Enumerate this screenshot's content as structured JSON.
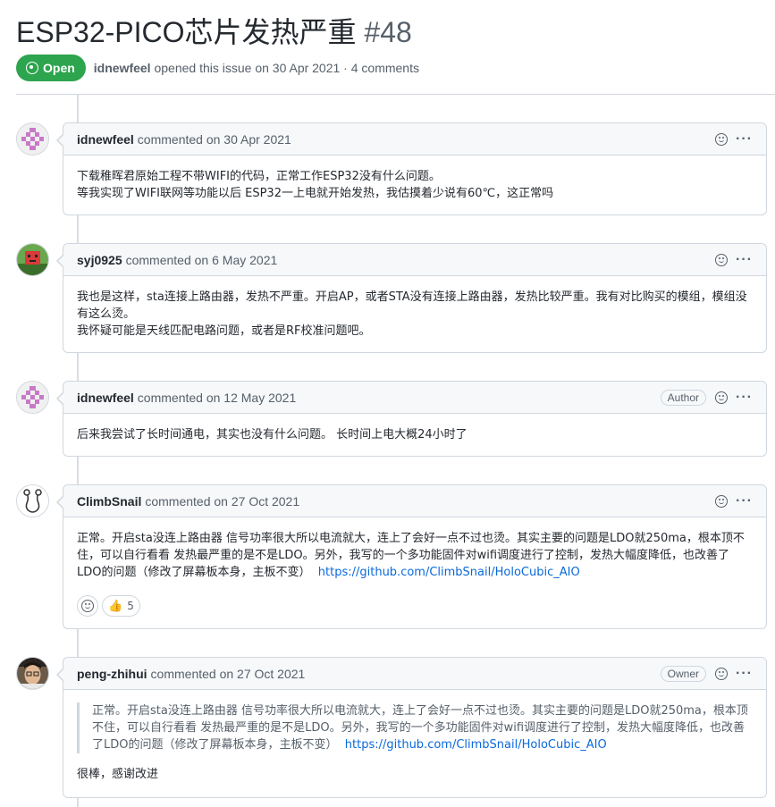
{
  "issue": {
    "title": "ESP32-PICO芯片发热严重",
    "number": "#48",
    "state": "Open",
    "opened_by": "idnewfeel",
    "opened_text": "opened this issue on 30 Apr 2021 · 4 comments"
  },
  "comments": [
    {
      "author": "idnewfeel",
      "meta": "commented on 30 Apr 2021",
      "badge": "",
      "lines": [
        "下载稚晖君原始工程不带WIFI的代码，正常工作ESP32没有什么问题。",
        "等我实现了WIFI联网等功能以后 ESP32一上电就开始发热，我估摸着少说有60℃，这正常吗"
      ]
    },
    {
      "author": "syj0925",
      "meta": "commented on 6 May 2021",
      "badge": "",
      "lines": [
        "我也是这样，sta连接上路由器，发热不严重。开启AP，或者STA没有连接上路由器，发热比较严重。我有对比购买的模组，模组没有这么烫。",
        "我怀疑可能是天线匹配电路问题，或者是RF校准问题吧。"
      ]
    },
    {
      "author": "idnewfeel",
      "meta": "commented on 12 May 2021",
      "badge": "Author",
      "lines": [
        "后来我尝试了长时间通电，其实也没有什么问题。 长时间上电大概24小时了"
      ]
    },
    {
      "author": "ClimbSnail",
      "meta": "commented on 27 Oct 2021",
      "badge": "",
      "text": "正常。开启sta没连上路由器 信号功率很大所以电流就大，连上了会好一点不过也烫。其实主要的问题是LDO就250ma，根本顶不住，可以自行看看 发热最严重的是不是LDO。另外，我写的一个多功能固件对wifi调度进行了控制，发热大幅度降低，也改善了LDO的问题（修改了屏幕板本身，主板不变）",
      "link": "https://github.com/ClimbSnail/HoloCubic_AIO",
      "reaction_count": "5"
    },
    {
      "author": "peng-zhihui",
      "meta": "commented on 27 Oct 2021",
      "badge": "Owner",
      "quote_text": "正常。开启sta没连上路由器 信号功率很大所以电流就大，连上了会好一点不过也烫。其实主要的问题是LDO就250ma，根本顶不住，可以自行看看 发热最严重的是不是LDO。另外，我写的一个多功能固件对wifi调度进行了控制，发热大幅度降低，也改善了LDO的问题（修改了屏幕板本身，主板不变）",
      "quote_link": "https://github.com/ClimbSnail/HoloCubic_AIO",
      "reply": "很棒，感谢改进"
    }
  ],
  "colors": {
    "open_green": "#2da44e",
    "link_blue": "#0969da"
  },
  "icons": [
    "issue-open-icon",
    "smiley-icon",
    "kebab-horizontal-icon",
    "thumbs-up-icon"
  ]
}
